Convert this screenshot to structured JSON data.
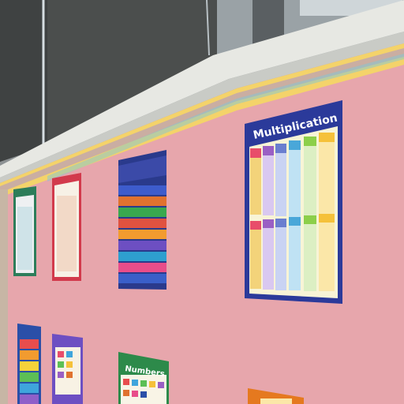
{
  "scene": {
    "wall_color": "#e7a6ac",
    "blind_color": "#4b4e4d",
    "border_palette": [
      "#f2c94c",
      "#9b87c5",
      "#7fc8d6",
      "#f29bb4",
      "#8ecf7c",
      "#f7a35c"
    ]
  },
  "posters": {
    "multiplication": {
      "title": "Multiplication",
      "column_colors": [
        "#e84d6a",
        "#9a5fc4",
        "#6a7ecf",
        "#49a7d9",
        "#8ccf4a",
        "#f5c13a"
      ]
    },
    "numbers": {
      "title": "Numbers"
    }
  }
}
